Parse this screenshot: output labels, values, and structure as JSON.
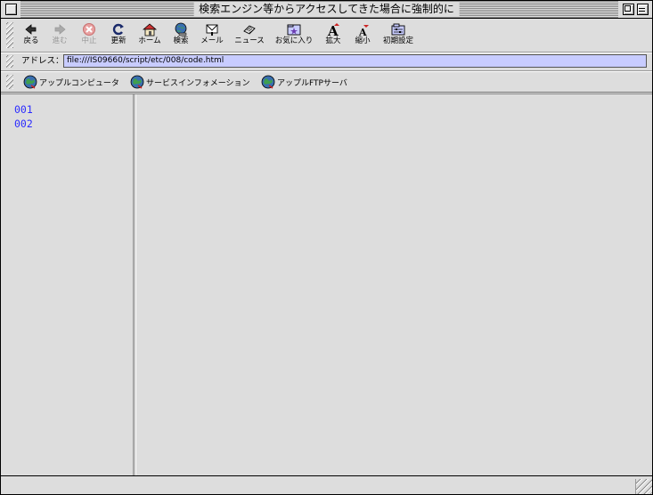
{
  "window": {
    "title": "検索エンジン等からアクセスしてきた場合に強制的に"
  },
  "toolbar": {
    "buttons": [
      {
        "label": "戻る",
        "icon": "back-arrow-icon",
        "enabled": true
      },
      {
        "label": "進む",
        "icon": "forward-arrow-icon",
        "enabled": false
      },
      {
        "label": "中止",
        "icon": "stop-icon",
        "enabled": false
      },
      {
        "label": "更新",
        "icon": "refresh-icon",
        "enabled": true
      },
      {
        "label": "ホーム",
        "icon": "home-icon",
        "enabled": true
      },
      {
        "label": "検索",
        "icon": "search-globe-icon",
        "enabled": true
      },
      {
        "label": "メール",
        "icon": "mail-icon",
        "enabled": true
      },
      {
        "label": "ニュース",
        "icon": "news-icon",
        "enabled": true
      },
      {
        "label": "お気に入り",
        "icon": "favorites-icon",
        "enabled": true
      },
      {
        "label": "拡大",
        "icon": "text-larger-icon",
        "enabled": true
      },
      {
        "label": "縮小",
        "icon": "text-smaller-icon",
        "enabled": true
      },
      {
        "label": "初期設定",
        "icon": "preferences-icon",
        "enabled": true
      }
    ]
  },
  "address": {
    "label": "アドレス：",
    "url": "file:///IS09660/script/etc/008/code.html"
  },
  "favorites": [
    {
      "label": "アップルコンピュータ",
      "icon": "globe-icon"
    },
    {
      "label": "サービスインフォメーション",
      "icon": "globe-icon"
    },
    {
      "label": "アップルFTPサーバ",
      "icon": "globe-icon"
    }
  ],
  "left_frame": {
    "links": [
      "001",
      "002"
    ]
  },
  "colors": {
    "link": "#2b2bff",
    "address_field": "#c8ccff",
    "chrome": "#dddddd"
  }
}
